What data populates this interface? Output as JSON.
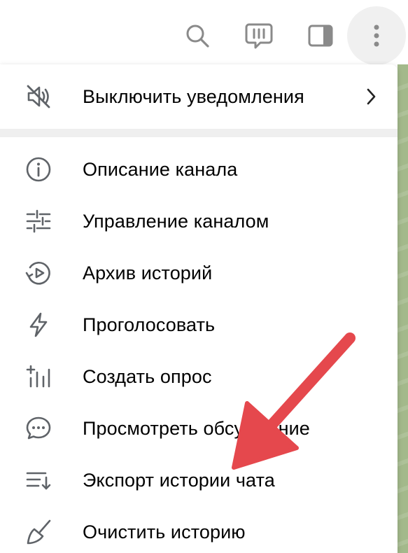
{
  "header": {
    "icons": [
      "search-icon",
      "voice-chat-icon",
      "side-panel-icon",
      "more-vertical-icon"
    ]
  },
  "menu": {
    "mute": {
      "label": "Выключить уведомления",
      "icon": "speaker-muted-icon"
    },
    "items": [
      {
        "label": "Описание канала",
        "icon": "info-icon"
      },
      {
        "label": "Управление каналом",
        "icon": "sliders-icon"
      },
      {
        "label": "Архив историй",
        "icon": "stories-archive-icon"
      },
      {
        "label": "Проголосовать",
        "icon": "boost-lightning-icon"
      },
      {
        "label": "Создать опрос",
        "icon": "create-poll-icon"
      },
      {
        "label": "Просмотреть обсуждение",
        "icon": "discussion-icon"
      },
      {
        "label": "Экспорт истории чата",
        "icon": "export-history-icon"
      },
      {
        "label": "Очистить историю",
        "icon": "broom-icon"
      }
    ]
  },
  "annotation": {
    "arrow_color": "#e5484d"
  },
  "colors": {
    "icon": "#5f6368",
    "text": "#000000",
    "separator": "#efefef",
    "chat_background": "#a3b98b"
  }
}
